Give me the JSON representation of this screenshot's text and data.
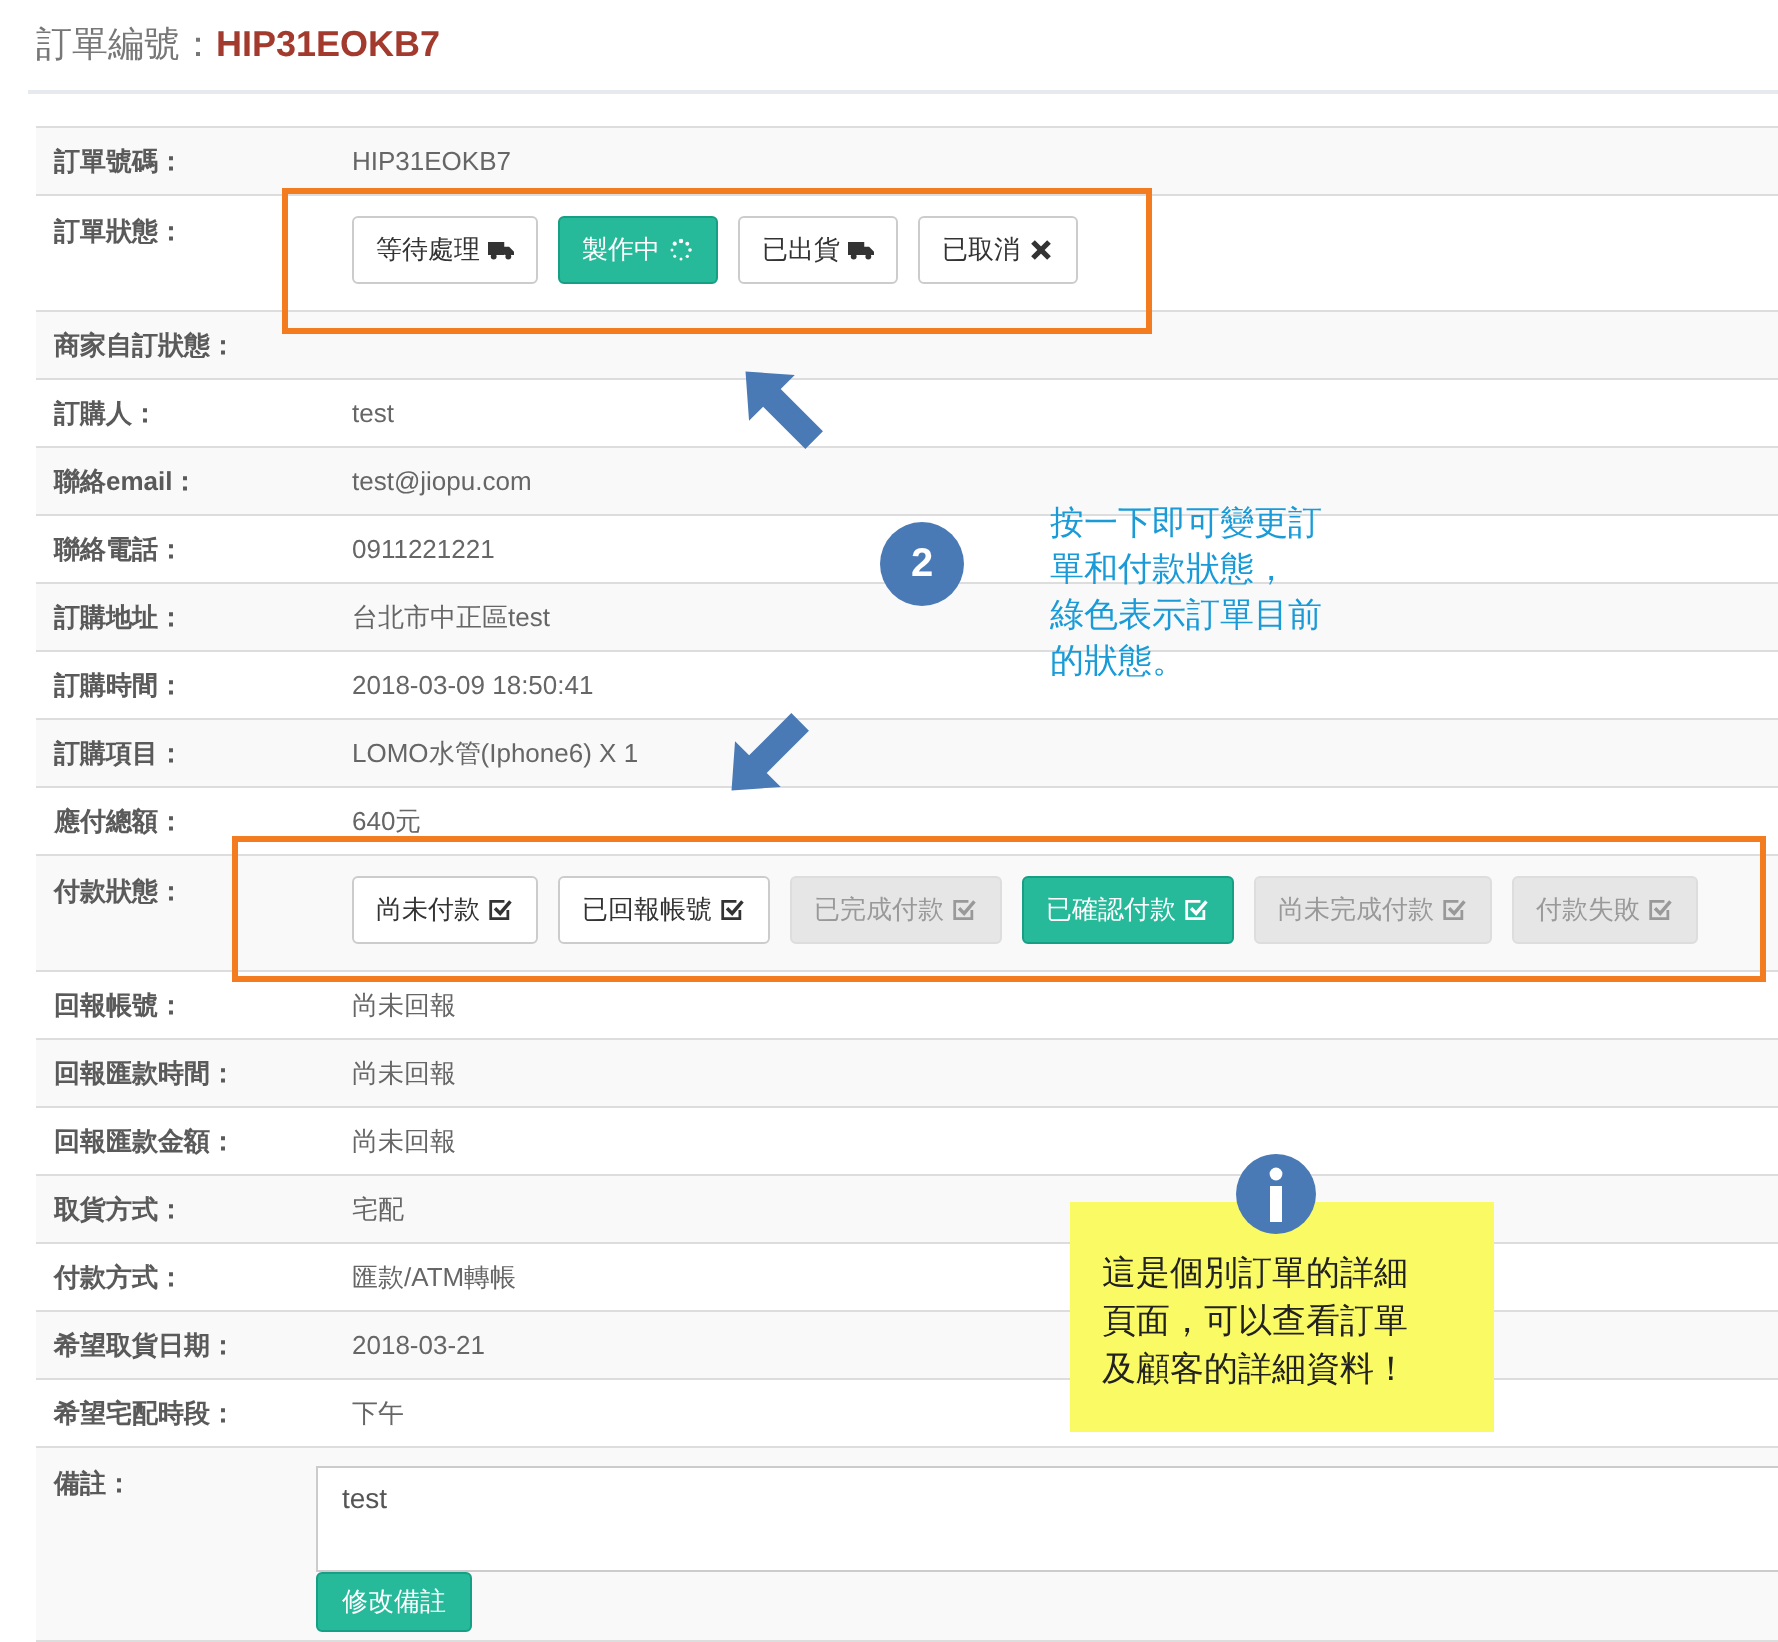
{
  "title": {
    "label": "訂單編號：",
    "value": "HIP31EOKB7"
  },
  "rows": [
    {
      "label": "訂單號碼：",
      "kind": "text",
      "value": "HIP31EOKB7"
    },
    {
      "label": "訂單狀態：",
      "kind": "buttons",
      "buttons": [
        {
          "label": "等待處理",
          "kind": "truck",
          "selected": false,
          "disabled": false
        },
        {
          "label": "製作中",
          "kind": "spinner",
          "selected": true,
          "disabled": false
        },
        {
          "label": "已出貨",
          "kind": "truck",
          "selected": false,
          "disabled": false
        },
        {
          "label": "已取消",
          "kind": "times",
          "selected": false,
          "disabled": false
        }
      ]
    },
    {
      "label": "商家自訂狀態：",
      "kind": "text"
    },
    {
      "label": "訂購人：",
      "kind": "text",
      "value": "test"
    },
    {
      "label": "聯絡email：",
      "kind": "text",
      "value": "test@jiopu.com"
    },
    {
      "label": "聯絡電話：",
      "kind": "text",
      "value": "0911221221"
    },
    {
      "label": "訂購地址：",
      "kind": "text",
      "value": "台北市中正區test"
    },
    {
      "label": "訂購時間：",
      "kind": "text",
      "value": "2018-03-09 18:50:41"
    },
    {
      "label": "訂購項目：",
      "kind": "text",
      "value": "LOMO水管(Iphone6) X 1"
    },
    {
      "label": "應付總額：",
      "kind": "text",
      "value": "640元"
    },
    {
      "label": "付款狀態：",
      "kind": "buttons",
      "buttons": [
        {
          "label": "尚未付款",
          "kind": "check",
          "selected": false,
          "disabled": false
        },
        {
          "label": "已回報帳號",
          "kind": "check",
          "selected": false,
          "disabled": false
        },
        {
          "label": "已完成付款",
          "kind": "check",
          "selected": false,
          "disabled": true
        },
        {
          "label": "已確認付款",
          "kind": "check",
          "selected": true,
          "disabled": false
        },
        {
          "label": "尚未完成付款",
          "kind": "check",
          "selected": false,
          "disabled": true
        },
        {
          "label": "付款失敗",
          "kind": "check",
          "selected": false,
          "disabled": true
        }
      ]
    },
    {
      "label": "回報帳號：",
      "kind": "text",
      "value": "尚未回報"
    },
    {
      "label": "回報匯款時間：",
      "kind": "text",
      "value": "尚未回報"
    },
    {
      "label": "回報匯款金額：",
      "kind": "text",
      "value": "尚未回報"
    },
    {
      "label": "取貨方式：",
      "kind": "text",
      "value": "宅配"
    },
    {
      "label": "付款方式：",
      "kind": "text",
      "value": "匯款/ATM轉帳"
    },
    {
      "label": "希望取貨日期：",
      "kind": "text",
      "value": "2018-03-21"
    },
    {
      "label": "希望宅配時段：",
      "kind": "text",
      "value": "下午"
    },
    {
      "label": "備註：",
      "kind": "textarea",
      "value": "test",
      "button": "修改備註"
    }
  ],
  "callout": {
    "number": "2",
    "lines": [
      "按一下即可變更訂",
      "單和付款狀態，",
      "綠色表示訂單目前",
      "的狀態。"
    ]
  },
  "note": {
    "lines": [
      "這是個別訂單的詳細",
      "頁面，可以查看訂單",
      "及顧客的詳細資料！"
    ]
  }
}
